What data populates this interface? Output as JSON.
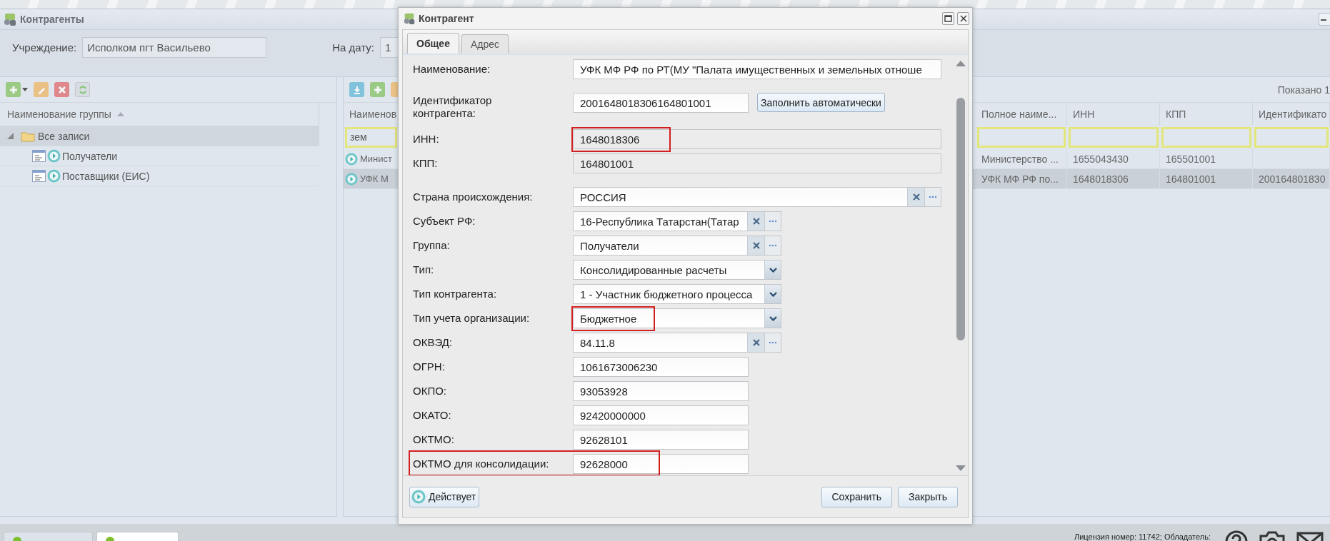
{
  "main_window": {
    "title": "Контрагенты"
  },
  "filters": {
    "institution_label": "Учреждение:",
    "institution_value": "Исполком пгт Васильево",
    "date_label": "На дату:",
    "date_value": "1"
  },
  "groups_panel": {
    "column": "Наименование группы",
    "tree": [
      {
        "label": "Все записи",
        "expanded": true,
        "selected": true,
        "children": [
          {
            "label": "Получатели",
            "selected": false
          },
          {
            "label": "Поставщики (ЕИС)",
            "selected": false
          }
        ]
      }
    ]
  },
  "list_panel": {
    "shown": "Показано 1",
    "columns": [
      "Наименов",
      "Полное наиме...",
      "ИНН",
      "КПП",
      "Идентификато"
    ],
    "name_filter": "зем",
    "rows": [
      {
        "name": "Минист",
        "full_name": "Министерство ...",
        "inn": "1655043430",
        "kpp": "165501001",
        "selected": false
      },
      {
        "name": "УФК М",
        "full_name": "УФК МФ РФ по...",
        "inn": "1648018306",
        "kpp": "164801001",
        "identifier": "200164801830",
        "selected": true
      }
    ]
  },
  "dialog": {
    "title": "Контрагент",
    "tabs": [
      {
        "label": "Общее",
        "selected": true
      },
      {
        "label": "Адрес",
        "selected": false
      }
    ],
    "groups": [
      {
        "fields": [
          {
            "label": "Наименование:",
            "value": "УФК МФ РФ по РТ(МУ \"Палата имущественных и земельных отноше",
            "kind": "text",
            "wide": true,
            "highlighted": false,
            "label_highlighted": false
          },
          {
            "label": "Идентификатор контрагента:",
            "value": "2001648018306164801001",
            "kind": "button",
            "button": "Заполнить автоматически",
            "wide": false,
            "highlighted": false,
            "label_highlighted": false
          },
          {
            "label": "ИНН:",
            "value": "1648018306",
            "kind": "readonly",
            "wide": true,
            "highlighted": true,
            "label_highlighted": false
          },
          {
            "label": "КПП:",
            "value": "164801001",
            "kind": "readonly",
            "wide": true,
            "highlighted": false,
            "label_highlighted": false
          }
        ]
      },
      {
        "fields": [
          {
            "label": "Страна происхождения:",
            "value": "РОССИЯ",
            "kind": "lookup",
            "wide": true,
            "highlighted": false,
            "label_highlighted": false
          },
          {
            "label": "Субъект РФ:",
            "value": "16-Республика Татарстан(Татар",
            "kind": "lookup",
            "wide": false,
            "highlighted": false,
            "label_highlighted": false
          },
          {
            "label": "Группа:",
            "value": "Получатели",
            "kind": "lookup",
            "wide": false,
            "highlighted": false,
            "label_highlighted": false
          },
          {
            "label": "Тип:",
            "value": "Консолидированные расчеты",
            "kind": "combo",
            "wide": false,
            "highlighted": false,
            "label_highlighted": false
          },
          {
            "label": "Тип контрагента:",
            "value": "1 - Участник бюджетного процесса",
            "kind": "combo",
            "wide": false,
            "highlighted": false,
            "label_highlighted": false
          },
          {
            "label": "Тип учета организации:",
            "value": "Бюджетное",
            "kind": "combo",
            "wide": false,
            "highlighted": true,
            "label_highlighted": false
          },
          {
            "label": "ОКВЭД:",
            "value": "84.11.8",
            "kind": "lookup",
            "wide": false,
            "highlighted": false,
            "label_highlighted": false
          },
          {
            "label": "ОГРН:",
            "value": "1061673006230",
            "kind": "text",
            "wide": false,
            "highlighted": false,
            "label_highlighted": false
          },
          {
            "label": "ОКПО:",
            "value": "93053928",
            "kind": "text",
            "wide": false,
            "highlighted": false,
            "label_highlighted": false
          },
          {
            "label": "ОКАТО:",
            "value": "92420000000",
            "kind": "text",
            "wide": false,
            "highlighted": false,
            "label_highlighted": false
          },
          {
            "label": "ОКТМО:",
            "value": "92628101",
            "kind": "text",
            "wide": false,
            "highlighted": false,
            "label_highlighted": false
          },
          {
            "label": "ОКТМО для консолидации:",
            "value": "92628000",
            "kind": "text",
            "wide": false,
            "highlighted": true,
            "label_highlighted": true
          }
        ]
      }
    ],
    "status_button": "Действует",
    "buttons": [
      "Сохранить",
      "Закрыть"
    ]
  },
  "taskbar": {
    "tabs": [
      {
        "selected": false
      },
      {
        "selected": true
      }
    ]
  },
  "license": "Лицензия номер: 11742; Обладатель:"
}
